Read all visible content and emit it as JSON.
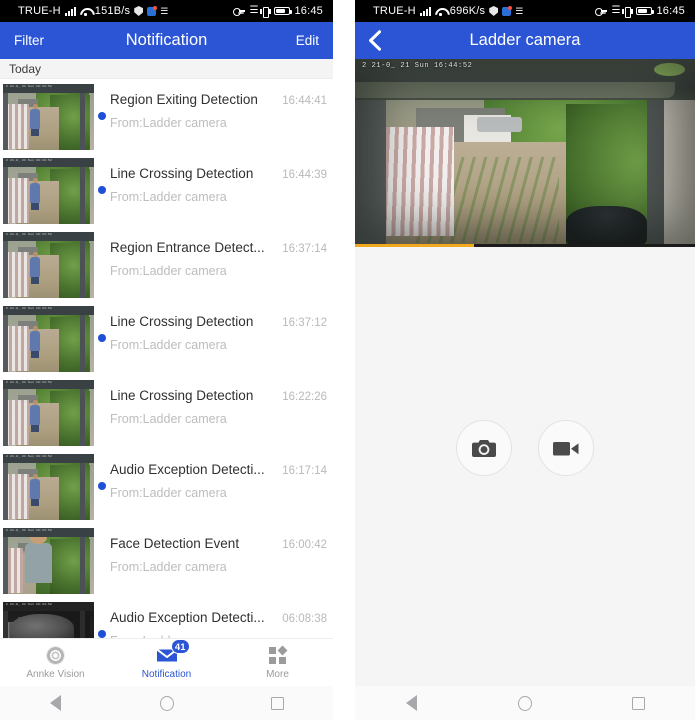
{
  "left_phone": {
    "status_bar": {
      "carrier": "TRUE-H",
      "data_rate": "151B/s",
      "clock": "16:45",
      "icons": [
        "signal-icon",
        "wifi-icon",
        "shield-icon",
        "app-icon",
        "message-icon",
        "key-icon",
        "bluetooth-icon",
        "vibrate-icon",
        "battery-icon"
      ]
    },
    "app_bar": {
      "filter_label": "Filter",
      "title": "Notification",
      "edit_label": "Edit",
      "background": "#2b55d4"
    },
    "section_header": "Today",
    "notifications": [
      {
        "title": "Region Exiting Detection",
        "source": "From:Ladder camera",
        "time": "16:44:41",
        "unread": true,
        "thumb": "path"
      },
      {
        "title": "Line Crossing Detection",
        "source": "From:Ladder camera",
        "time": "16:44:39",
        "unread": true,
        "thumb": "path"
      },
      {
        "title": "Region Entrance Detect...",
        "source": "From:Ladder camera",
        "time": "16:37:14",
        "unread": false,
        "thumb": "path"
      },
      {
        "title": "Line Crossing Detection",
        "source": "From:Ladder camera",
        "time": "16:37:12",
        "unread": true,
        "thumb": "path"
      },
      {
        "title": "Line Crossing Detection",
        "source": "From:Ladder camera",
        "time": "16:22:26",
        "unread": false,
        "thumb": "path"
      },
      {
        "title": "Audio Exception Detecti...",
        "source": "From:Ladder camera",
        "time": "16:17:14",
        "unread": true,
        "thumb": "path"
      },
      {
        "title": "Face Detection Event",
        "source": "From:Ladder camera",
        "time": "16:00:42",
        "unread": false,
        "thumb": "face"
      },
      {
        "title": "Audio Exception Detecti...",
        "source": "From:Ladder camera",
        "time": "06:08:38",
        "unread": true,
        "thumb": "night"
      }
    ],
    "bottom_nav": [
      {
        "label": "Annke Vision",
        "icon": "camera-lens-icon",
        "active": false,
        "badge": null
      },
      {
        "label": "Notification",
        "icon": "envelope-icon",
        "active": true,
        "badge": "41"
      },
      {
        "label": "More",
        "icon": "grid-icon",
        "active": false,
        "badge": null
      }
    ],
    "android_nav": [
      "back-icon",
      "home-icon",
      "recents-icon"
    ]
  },
  "right_phone": {
    "status_bar": {
      "carrier": "TRUE-H",
      "data_rate": "696K/s",
      "clock": "16:45",
      "icons": [
        "signal-icon",
        "wifi-icon",
        "shield-icon",
        "app-icon",
        "message-icon",
        "key-icon",
        "bluetooth-icon",
        "vibrate-icon",
        "battery-icon"
      ]
    },
    "app_bar": {
      "back_icon": "chevron-left-icon",
      "title": "Ladder camera",
      "background": "#2b55d4"
    },
    "video": {
      "overlay_timestamp": "2 21-0_ 21 Sun 16:44:52",
      "progress_percent": 35,
      "progress_color": "#f0a81f"
    },
    "controls": [
      {
        "name": "snapshot-button",
        "icon": "camera-icon"
      },
      {
        "name": "record-button",
        "icon": "video-camera-icon"
      }
    ],
    "android_nav": [
      "back-icon",
      "home-icon",
      "recents-icon"
    ]
  }
}
